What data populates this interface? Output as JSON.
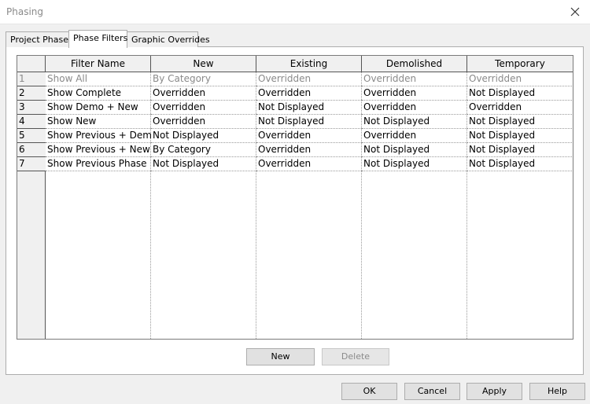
{
  "window": {
    "title": "Phasing"
  },
  "tabs": [
    {
      "label": "Project Phases"
    },
    {
      "label": "Phase Filters"
    },
    {
      "label": "Graphic Overrides"
    }
  ],
  "table": {
    "columns": [
      "Filter Name",
      "New",
      "Existing",
      "Demolished",
      "Temporary"
    ],
    "rows": [
      {
        "num": "1",
        "cells": [
          "Show All",
          "By Category",
          "Overridden",
          "Overridden",
          "Overridden"
        ]
      },
      {
        "num": "2",
        "cells": [
          "Show Complete",
          "Overridden",
          "Overridden",
          "Overridden",
          "Not Displayed"
        ]
      },
      {
        "num": "3",
        "cells": [
          "Show Demo + New",
          "Overridden",
          "Not Displayed",
          "Overridden",
          "Overridden"
        ]
      },
      {
        "num": "4",
        "cells": [
          "Show New",
          "Overridden",
          "Not Displayed",
          "Not Displayed",
          "Not Displayed"
        ]
      },
      {
        "num": "5",
        "cells": [
          "Show Previous + Demo",
          "Not Displayed",
          "Overridden",
          "Overridden",
          "Not Displayed"
        ]
      },
      {
        "num": "6",
        "cells": [
          "Show Previous + New",
          "By Category",
          "Overridden",
          "Not Displayed",
          "Not Displayed"
        ]
      },
      {
        "num": "7",
        "cells": [
          "Show Previous Phase",
          "Not Displayed",
          "Overridden",
          "Not Displayed",
          "Not Displayed"
        ]
      }
    ]
  },
  "buttons": {
    "new": "New",
    "delete": "Delete",
    "ok": "OK",
    "cancel": "Cancel",
    "apply": "Apply",
    "help": "Help"
  }
}
